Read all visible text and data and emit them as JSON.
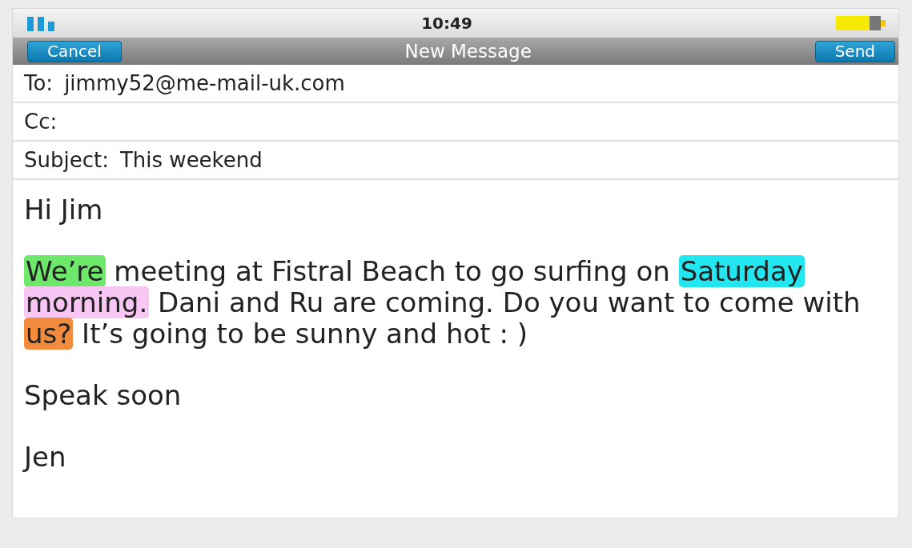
{
  "status_bar": {
    "time": "10:49"
  },
  "nav_bar": {
    "cancel": "Cancel",
    "title": "New Message",
    "send": "Send"
  },
  "fields": [
    {
      "label": "To:",
      "value": "jimmy52@me-mail-uk.com"
    },
    {
      "label": "Cc:"
    },
    {
      "label": "Subject:",
      "value": "This weekend"
    }
  ],
  "body": [
    {
      "segments": [
        {
          "text": "Hi Jim"
        }
      ]
    },
    {
      "segments": [
        {
          "text": "We’re",
          "color": "#6ee86a"
        },
        {
          "text": " meeting at Fistral Beach to go surfing on "
        },
        {
          "text": "Saturday",
          "color": "#22e6f0"
        },
        {
          "text": "morning.",
          "color": "#f8c6f2",
          "space_before": true
        },
        {
          "text": " Dani and Ru are coming. Do you want to come with "
        },
        {
          "text": "us?",
          "color": "#f28c3c"
        },
        {
          "text": " It’s going to be sunny and hot : )"
        }
      ]
    },
    {
      "segments": [
        {
          "text": "Speak soon"
        }
      ]
    },
    {
      "segments": [
        {
          "text": "Jen"
        }
      ]
    }
  ]
}
